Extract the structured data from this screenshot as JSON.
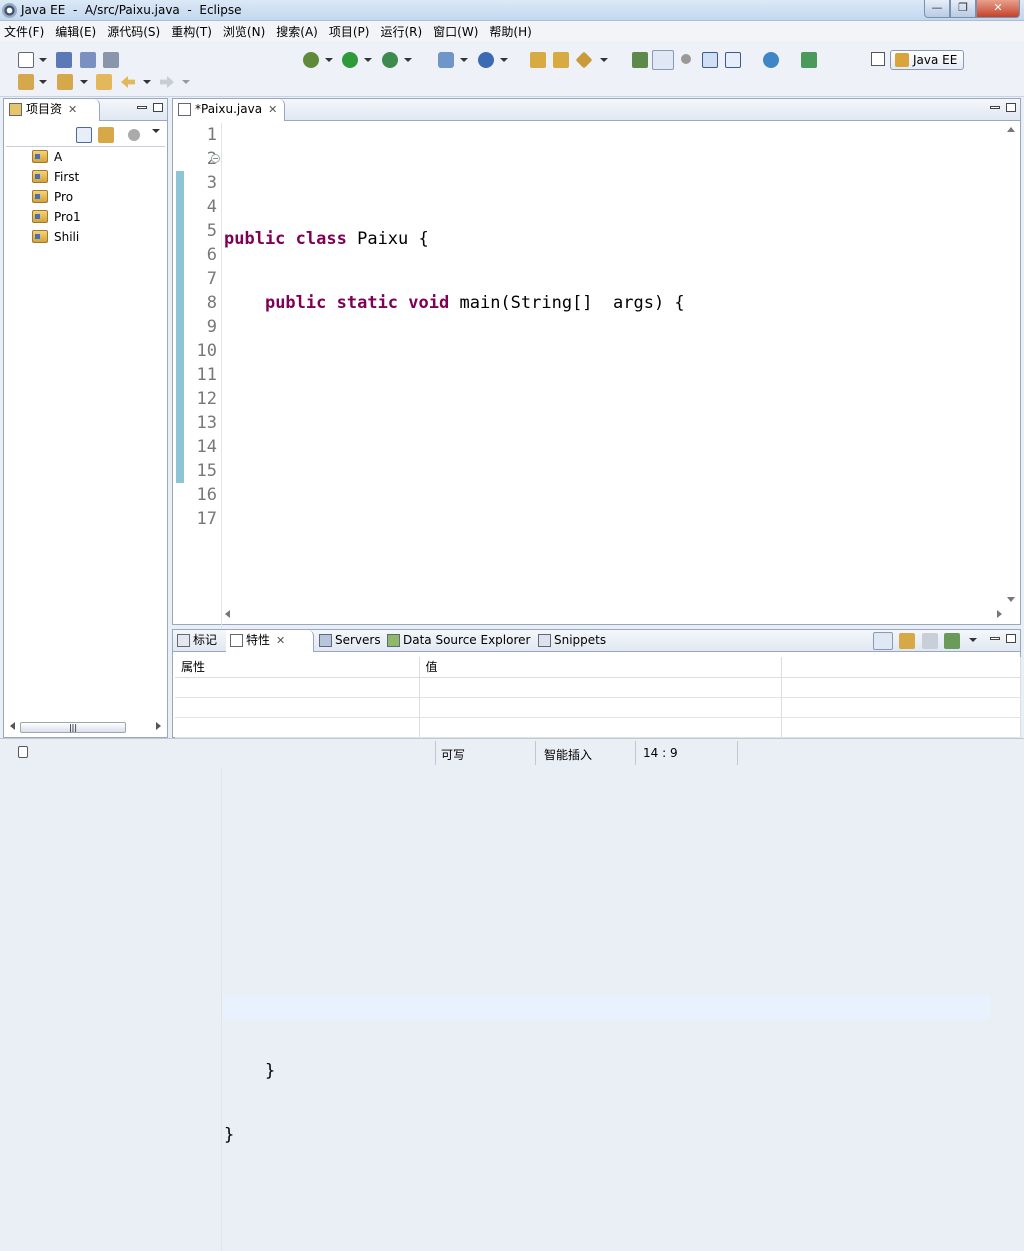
{
  "window": {
    "title": "Java EE  -  A/src/Paixu.java  -  Eclipse"
  },
  "menu": [
    "文件(F)",
    "编辑(E)",
    "源代码(S)",
    "重构(T)",
    "浏览(N)",
    "搜索(A)",
    "项目(P)",
    "运行(R)",
    "窗口(W)",
    "帮助(H)"
  ],
  "perspective": {
    "label": "Java EE"
  },
  "project_explorer": {
    "title": "项目资",
    "projects": [
      "A",
      "First",
      "Pro",
      "Pro1",
      "Shili"
    ]
  },
  "editor": {
    "tab_label": "*Paixu.java",
    "line_numbers": [
      "1",
      "2",
      "3",
      "4",
      "5",
      "6",
      "7",
      "8",
      "9",
      "10",
      "11",
      "12",
      "13",
      "14",
      "15",
      "16",
      "17"
    ],
    "lines": {
      "l2_kw1": "public",
      "l2_kw2": "class",
      "l2_rest": " Paixu {",
      "l3_kw1": "public",
      "l3_kw2": "static",
      "l3_kw3": "void",
      "l3_rest": " main(String[]  args) {",
      "l15": "    }",
      "l16": "}"
    }
  },
  "bottom_panel": {
    "tabs": [
      "标记",
      "特性",
      "Servers",
      "Data Source Explorer",
      "Snippets"
    ],
    "columns": [
      "属性",
      "值"
    ]
  },
  "status": {
    "writable": "可写",
    "insert_mode": "智能插入",
    "position": "14 : 9"
  },
  "colors": {
    "keyword": "#7f0055",
    "current_line": "#e8f2fe",
    "accent": "#8fc4d4"
  }
}
